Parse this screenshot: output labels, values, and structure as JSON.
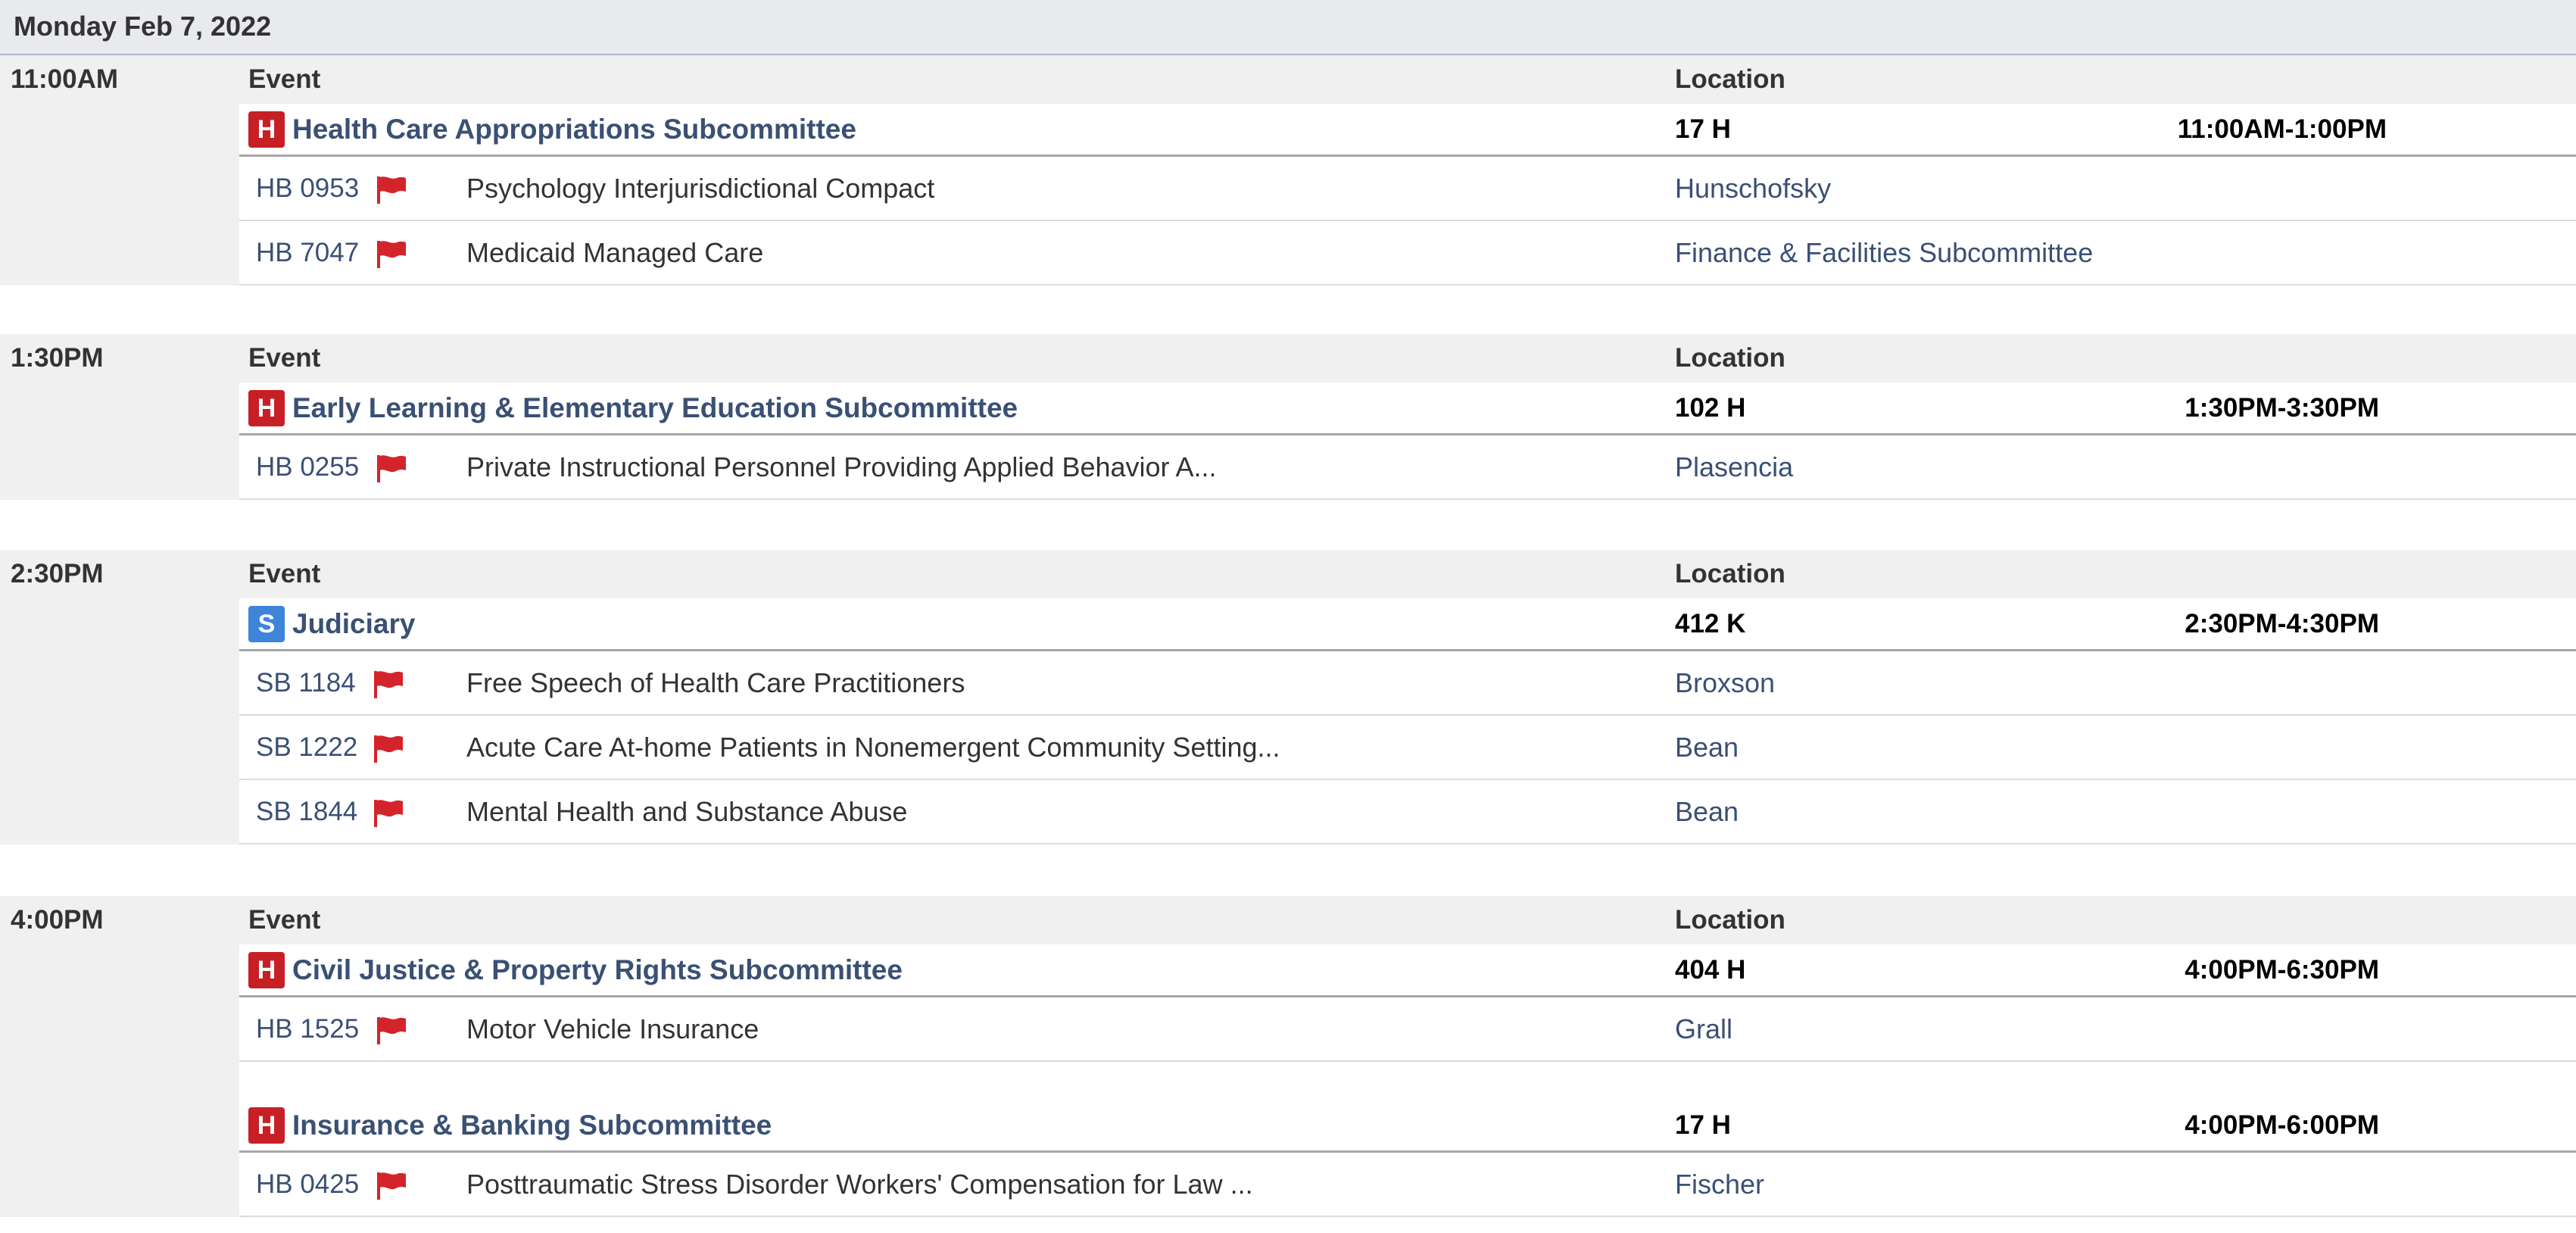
{
  "date_label": "Monday Feb 7, 2022",
  "column_headers": {
    "event": "Event",
    "location": "Location"
  },
  "colors": {
    "house_badge": "#c62026",
    "senate_badge": "#3d85d8",
    "link": "#3a5074",
    "flag": "#d4242b"
  },
  "icons": {
    "house_badge": "H",
    "senate_badge": "S",
    "bill_flag": "flag-icon"
  },
  "slots": [
    {
      "time": "11:00AM",
      "events": [
        {
          "chamber": "H",
          "title": "Health Care Appropriations Subcommittee",
          "room": "17 H",
          "time_range": "11:00AM-1:00PM",
          "bills": [
            {
              "number": "HB 0953",
              "title": "Psychology Interjurisdictional Compact",
              "sponsor": "Hunschofsky"
            },
            {
              "number": "HB 7047",
              "title": "Medicaid Managed Care",
              "sponsor": "Finance & Facilities Subcommittee"
            }
          ]
        }
      ]
    },
    {
      "time": "1:30PM",
      "events": [
        {
          "chamber": "H",
          "title": "Early Learning & Elementary Education Subcommittee",
          "room": "102 H",
          "time_range": "1:30PM-3:30PM",
          "bills": [
            {
              "number": "HB 0255",
              "title": "Private Instructional Personnel Providing Applied Behavior A...",
              "sponsor": "Plasencia"
            }
          ]
        }
      ]
    },
    {
      "time": "2:30PM",
      "events": [
        {
          "chamber": "S",
          "title": "Judiciary",
          "room": "412 K",
          "time_range": "2:30PM-4:30PM",
          "bills": [
            {
              "number": "SB 1184",
              "title": "Free Speech of Health Care Practitioners",
              "sponsor": "Broxson"
            },
            {
              "number": "SB 1222",
              "title": "Acute Care At-home Patients in Nonemergent Community Setting...",
              "sponsor": "Bean"
            },
            {
              "number": "SB 1844",
              "title": "Mental Health and Substance Abuse",
              "sponsor": "Bean"
            }
          ]
        }
      ]
    },
    {
      "time": "4:00PM",
      "events": [
        {
          "chamber": "H",
          "title": "Civil Justice & Property Rights Subcommittee",
          "room": "404 H",
          "time_range": "4:00PM-6:30PM",
          "bills": [
            {
              "number": "HB 1525",
              "title": "Motor Vehicle Insurance",
              "sponsor": "Grall"
            }
          ]
        },
        {
          "chamber": "H",
          "title": "Insurance & Banking Subcommittee",
          "room": "17 H",
          "time_range": "4:00PM-6:00PM",
          "bills": [
            {
              "number": "HB 0425",
              "title": "Posttraumatic Stress Disorder Workers' Compensation for Law ...",
              "sponsor": "Fischer"
            }
          ]
        }
      ]
    }
  ]
}
